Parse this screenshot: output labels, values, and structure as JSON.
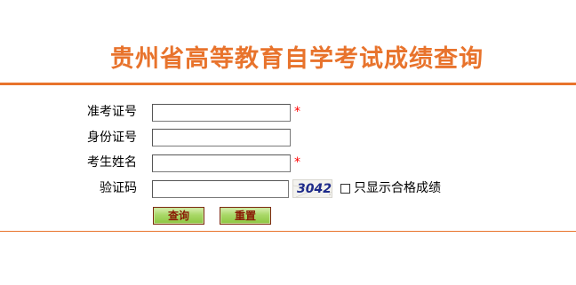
{
  "page": {
    "title": "贵州省高等教育自学考试成绩查询"
  },
  "form": {
    "ticket_label": "准考证号",
    "ticket_value": "",
    "id_label": "身份证号",
    "id_value": "",
    "name_label": "考生姓名",
    "name_value": "",
    "captcha_label": "验证码",
    "captcha_value": "",
    "captcha_code": "3042",
    "required_mark": "*",
    "pass_only_label": "只显示合格成绩",
    "pass_only_checked": false
  },
  "buttons": {
    "query_label": "查询",
    "reset_label": "重置"
  },
  "colors": {
    "accent": "#e8732c",
    "required": "#ff0000",
    "button_text": "#8a1a05",
    "button_fill": "#a9d868"
  }
}
